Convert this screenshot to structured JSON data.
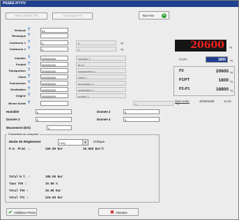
{
  "window": {
    "title": "PESEE N°/Y/V"
  },
  "toolbar": {
    "new_weighing": "Nvel Contrôle (F5)",
    "history": "Historique (F7)",
    "tare_fixed": "Tare Fixe"
  },
  "fields": [
    {
      "label": "Véhicule",
      "value": "01"
    },
    {
      "label": "Remorque",
      "value": ""
    },
    {
      "label": "Conteneur 1",
      "value": "0",
      "side": "0",
      "unit": "kg"
    },
    {
      "label": "Conteneur 2",
      "value": "0",
      "side": "0",
      "unit": "kg"
    },
    {
      "label": "Chantier",
      "value": "000000000",
      "side": "chantier 1"
    },
    {
      "label": "Produit",
      "value": "000000000",
      "side": "ltk p1"
    },
    {
      "label": "Transporteur",
      "value": "000000000",
      "side": "transporteur 1"
    },
    {
      "label": "Client",
      "value": "000000000",
      "side": "client 1"
    },
    {
      "label": "Fournisseur",
      "value": "000000000",
      "side": "fournisseur 1"
    },
    {
      "label": "Destination",
      "value": "000000000",
      "side": "destination 1"
    },
    {
      "label": "Origine",
      "value": "000000000",
      "side": "origine 1"
    },
    {
      "label": "Benne Sortie",
      "value": "",
      "side": "0",
      "unit": "kg"
    }
  ],
  "extras": {
    "humidite_label": "Humidité",
    "humidite": "0",
    "donnee2_label": "Donnée 2",
    "donnee2": "0",
    "donnee3_label": "Donnée 3",
    "donnee3": "0",
    "donnee4_label": "Donnée 4",
    "donnee4": "0",
    "mouvement_label": "Mouvement (E/S)",
    "mouvement": "0"
  },
  "weights": {
    "display": "20600",
    "display_unit": "kg",
    "p1pt_label": "P1/PT",
    "p1pt_input": "1800",
    "p1pt_unit": "kg",
    "rows": [
      {
        "label": "P2",
        "value": "20600",
        "unit": "kg"
      },
      {
        "label": "P1/PT",
        "value": "1800",
        "unit": "kg"
      },
      {
        "label": "P2-P1",
        "value": "18800",
        "unit": "kg"
      }
    ],
    "date_label": "Date sortie",
    "date": "30/05/2006",
    "time": "14:46"
  },
  "invoice": {
    "header": "Facturation au comptant",
    "mode_label": "Mode de Règlement",
    "mode_value": "CHQ",
    "mode_name": "Chèque",
    "unit_price_label": "P.U. Prod. :",
    "unit_price": "100.00 Eur",
    "unit_price2": "10.000 Eur/t",
    "lines": [
      {
        "label": "Total H.T. :",
        "value": "188.00 Eur"
      },
      {
        "label": "Taux TVA :",
        "value": "19.60 %"
      },
      {
        "label": "Total TVA :",
        "value": "36.85 Eur"
      },
      {
        "label": "Total TTC :",
        "value": "224.85 Eur"
      }
    ]
  },
  "footer": {
    "validate": "Validation Pesée",
    "cancel": "Abandon"
  },
  "colors": {
    "accent_blue": "#1f3f8f",
    "led_red": "#ff1f1f",
    "ok_green": "#2e9e2e",
    "cancel_red": "#cc1f1f"
  }
}
